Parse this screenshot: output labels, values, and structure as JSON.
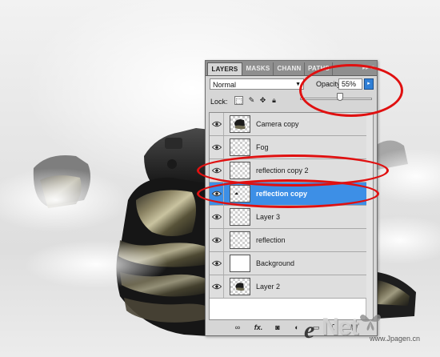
{
  "panel": {
    "tabs": [
      {
        "label": "LAYERS",
        "active": true
      },
      {
        "label": "MASKS",
        "active": false
      },
      {
        "label": "CHANN",
        "active": false
      },
      {
        "label": "PATHS",
        "active": false
      }
    ],
    "panel_controls": "▸▸ ≡",
    "blend_mode": "Normal",
    "opacity_label": "Opacity:",
    "opacity_value": "55%",
    "opacity_fraction": 0.55,
    "lock_label": "Lock:",
    "layers": [
      {
        "name": "Camera copy",
        "visible": true,
        "selected": false,
        "thumb": "camera"
      },
      {
        "name": "Fog",
        "visible": true,
        "selected": false,
        "thumb": "transparent"
      },
      {
        "name": "reflection copy 2",
        "visible": true,
        "selected": false,
        "thumb": "transparent"
      },
      {
        "name": "reflection copy",
        "visible": true,
        "selected": true,
        "thumb": "transparent-dark"
      },
      {
        "name": "Layer 3",
        "visible": true,
        "selected": false,
        "thumb": "transparent"
      },
      {
        "name": "reflection",
        "visible": true,
        "selected": false,
        "thumb": "transparent"
      },
      {
        "name": "Background",
        "visible": true,
        "selected": false,
        "thumb": "white"
      },
      {
        "name": "Layer 2",
        "visible": true,
        "selected": false,
        "thumb": "camera-small"
      }
    ],
    "bottom_icons": [
      "link-icon",
      "fx-icon",
      "mask-icon",
      "adjustment-icon",
      "folder-icon",
      "new-layer-icon",
      "trash-icon"
    ],
    "bottom_labels": {
      "fx": "fx."
    }
  },
  "colors": {
    "annotation_red": "#e01010",
    "selection_blue": "#3d8fe6"
  },
  "watermark": {
    "e": "e",
    "net": "Net",
    "sub": "www.Jpagen.cn"
  }
}
